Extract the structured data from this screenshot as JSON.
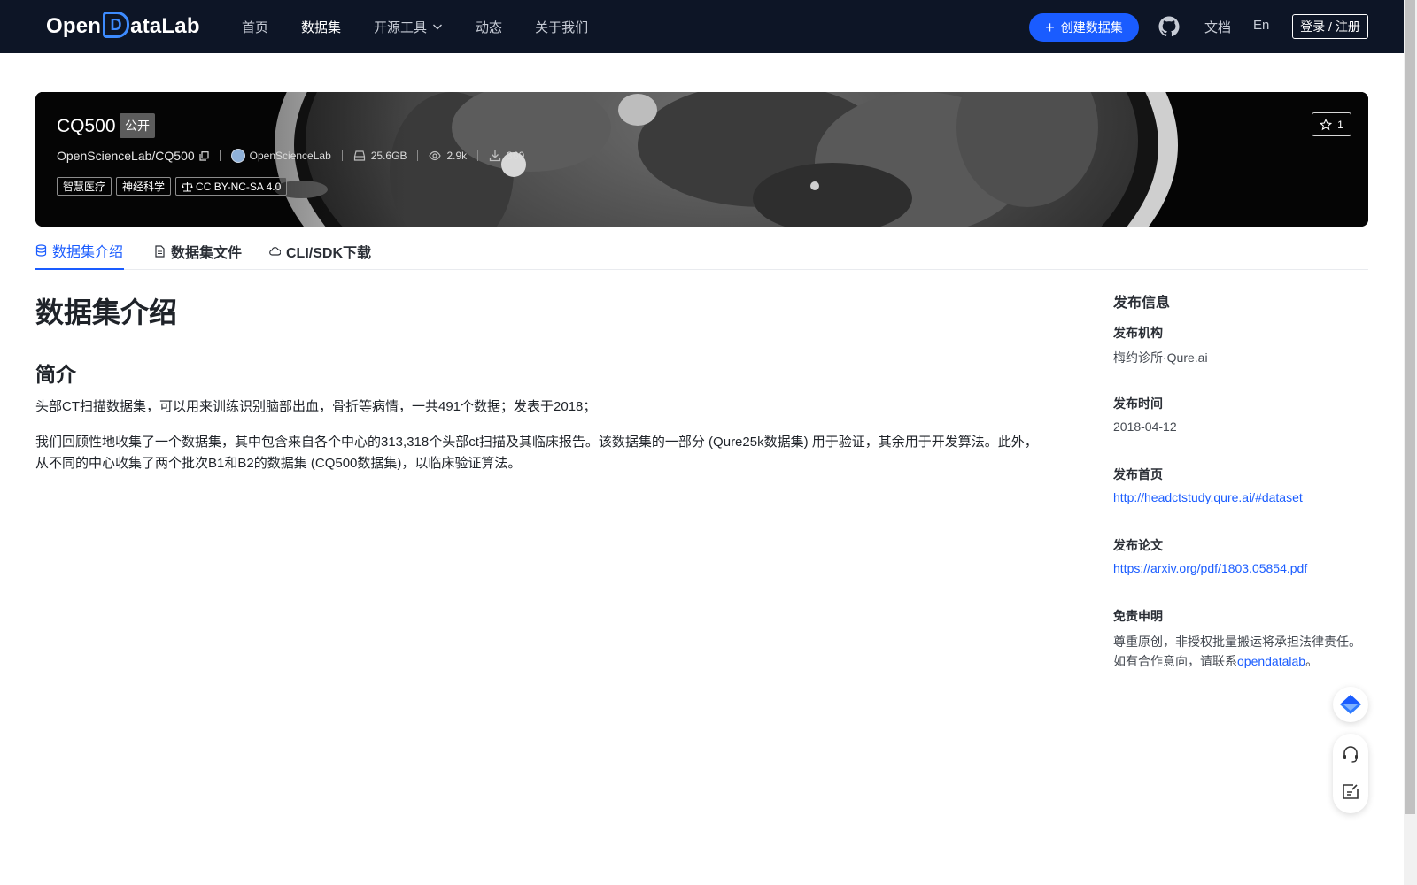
{
  "nav": {
    "logo": {
      "prefix": "Open",
      "d": "D",
      "suffix": "ataLab"
    },
    "items": [
      {
        "label": "首页"
      },
      {
        "label": "数据集",
        "active": true
      },
      {
        "label": "开源工具",
        "dropdown": true
      },
      {
        "label": "动态"
      },
      {
        "label": "关于我们"
      }
    ],
    "create_label": "创建数据集",
    "docs_label": "文档",
    "lang_label": "En",
    "login_label": "登录 / 注册"
  },
  "dataset": {
    "title": "CQ500",
    "visibility": "公开",
    "path": "OpenScienceLab/CQ500",
    "org": "OpenScienceLab",
    "size": "25.6GB",
    "views": "2.9k",
    "downloads": "360",
    "tags": [
      "智慧医疗",
      "神经科学"
    ],
    "license": "CC BY-NC-SA 4.0",
    "stars": "1"
  },
  "tabs": [
    {
      "label": "数据集介绍",
      "icon": "database-icon",
      "active": true
    },
    {
      "label": "数据集文件",
      "icon": "file-icon"
    },
    {
      "label": "CLI/SDK下载",
      "icon": "cloud-icon"
    }
  ],
  "content": {
    "heading": "数据集介绍",
    "subheading": "简介",
    "paragraphs": [
      "头部CT扫描数据集，可以用来训练识别脑部出血，骨折等病情，一共491个数据；发表于2018；",
      "我们回顾性地收集了一个数据集，其中包含来自各个中心的313,318个头部ct扫描及其临床报告。该数据集的一部分 (Qure25k数据集) 用于验证，其余用于开发算法。此外，从不同的中心收集了两个批次B1和B2的数据集 (CQ500数据集)，以临床验证算法。"
    ]
  },
  "sidebar": {
    "title": "发布信息",
    "org_label": "发布机构",
    "org_value": "梅约诊所·Qure.ai",
    "date_label": "发布时间",
    "date_value": "2018-04-12",
    "homepage_label": "发布首页",
    "homepage_value": "http://headctstudy.qure.ai/#dataset",
    "paper_label": "发布论文",
    "paper_value": "https://arxiv.org/pdf/1803.05854.pdf",
    "disclaimer_label": "免责申明",
    "disclaimer_line1": "尊重原创，非授权批量搬运将承担法律责任。",
    "disclaimer_line2_prefix": "如有合作意向，请联系",
    "disclaimer_link": "opendatalab",
    "disclaimer_line2_suffix": "。"
  },
  "colors": {
    "nav_bg": "#0d1526",
    "accent": "#1a5cff",
    "banner_bg": "#050505"
  }
}
